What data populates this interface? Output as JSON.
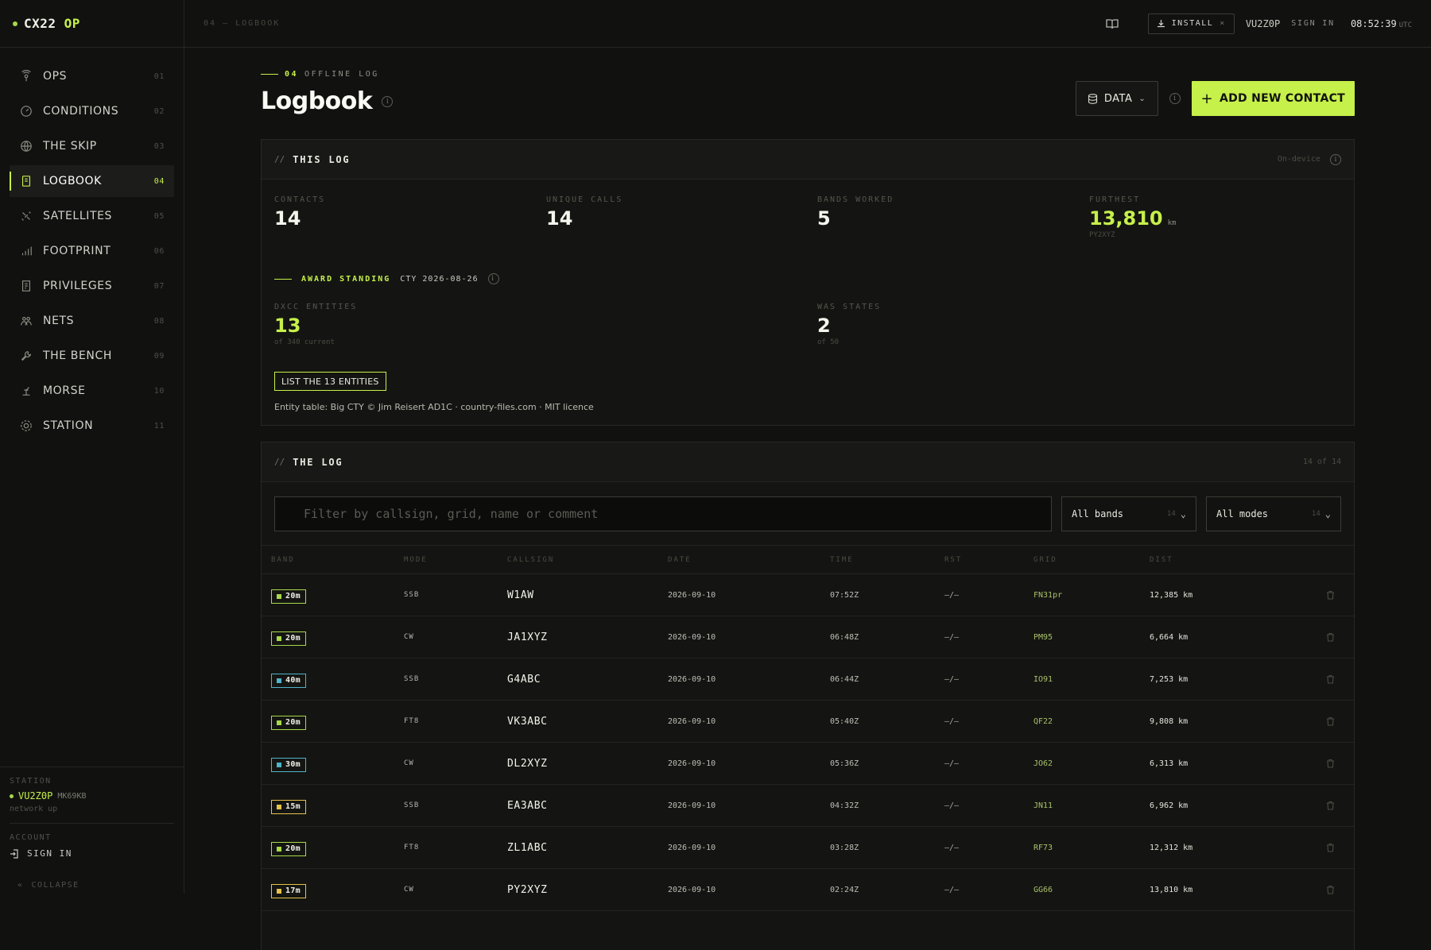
{
  "brand": {
    "name": "CX22",
    "suffix": "OP"
  },
  "crumb": "04 — LOGBOOK",
  "nav": [
    {
      "label": "OPS",
      "num": "01",
      "icon": "antenna-icon"
    },
    {
      "label": "CONDITIONS",
      "num": "02",
      "icon": "gauge-icon"
    },
    {
      "label": "THE SKIP",
      "num": "03",
      "icon": "globe-icon"
    },
    {
      "label": "LOGBOOK",
      "num": "04",
      "icon": "book-icon",
      "active": true
    },
    {
      "label": "SATELLITES",
      "num": "05",
      "icon": "satellite-icon"
    },
    {
      "label": "FOOTPRINT",
      "num": "06",
      "icon": "bars-icon"
    },
    {
      "label": "PRIVILEGES",
      "num": "07",
      "icon": "license-icon"
    },
    {
      "label": "NETS",
      "num": "08",
      "icon": "people-icon"
    },
    {
      "label": "THE BENCH",
      "num": "09",
      "icon": "wrench-icon"
    },
    {
      "label": "MORSE",
      "num": "10",
      "icon": "key-icon"
    },
    {
      "label": "STATION",
      "num": "11",
      "icon": "gear-icon"
    }
  ],
  "sidebar_bottom": {
    "station_label": "STATION",
    "station_call": "VU2Z0P",
    "station_grid": "MK69KB",
    "net_status": "network up",
    "account_label": "ACCOUNT",
    "signin": "SIGN IN",
    "collapse": "COLLAPSE"
  },
  "topbar": {
    "install": "INSTALL",
    "call": "VU2Z0P",
    "signin": "SIGN IN",
    "clock": "08:52:39",
    "tz": "UTC"
  },
  "header": {
    "eyebrow_num": "04",
    "eyebrow_text": "OFFLINE LOG",
    "title": "Logbook",
    "data_label": "DATA",
    "add_label": "ADD NEW CONTACT"
  },
  "this_log": {
    "title": "THIS LOG",
    "badge": "On-device",
    "stats": {
      "contacts": {
        "label": "CONTACTS",
        "value": "14"
      },
      "unique": {
        "label": "UNIQUE CALLS",
        "value": "14"
      },
      "bands": {
        "label": "BANDS WORKED",
        "value": "5"
      },
      "furthest": {
        "label": "FURTHEST",
        "value": "13,810",
        "unit": "km",
        "sub": "PY2XYZ"
      }
    },
    "award": {
      "label": "AWARD STANDING",
      "cty": "CTY 2026-08-26"
    },
    "dxcc": {
      "label": "DXCC ENTITIES",
      "value": "13",
      "sub": "of 340 current"
    },
    "was": {
      "label": "WAS STATES",
      "value": "2",
      "sub": "of 50"
    },
    "list_button": "LIST THE 13 ENTITIES",
    "credits": "Entity table: Big CTY © Jim Reisert AD1C · country-files.com · MIT licence"
  },
  "the_log": {
    "title": "THE LOG",
    "count": "14 of 14",
    "filter_placeholder": "Filter by callsign, grid, name or comment",
    "bands_select": "All bands",
    "bands_count": "14",
    "modes_select": "All modes",
    "modes_count": "14",
    "headers": {
      "band": "BAND",
      "mode": "MODE",
      "callsign": "CALLSIGN",
      "date": "DATE",
      "time": "TIME",
      "rst": "RST",
      "grid": "GRID",
      "dist": "DIST"
    },
    "rows": [
      {
        "band": "20m",
        "mode": "SSB",
        "call": "W1AW",
        "date": "2026-09-10",
        "time": "07:52Z",
        "rst": "–/–",
        "grid": "FN31pr",
        "dist": "12,385 km"
      },
      {
        "band": "20m",
        "mode": "CW",
        "call": "JA1XYZ",
        "date": "2026-09-10",
        "time": "06:48Z",
        "rst": "–/–",
        "grid": "PM95",
        "dist": "6,664 km"
      },
      {
        "band": "40m",
        "mode": "SSB",
        "call": "G4ABC",
        "date": "2026-09-10",
        "time": "06:44Z",
        "rst": "–/–",
        "grid": "IO91",
        "dist": "7,253 km"
      },
      {
        "band": "20m",
        "mode": "FT8",
        "call": "VK3ABC",
        "date": "2026-09-10",
        "time": "05:40Z",
        "rst": "–/–",
        "grid": "QF22",
        "dist": "9,808 km"
      },
      {
        "band": "30m",
        "mode": "CW",
        "call": "DL2XYZ",
        "date": "2026-09-10",
        "time": "05:36Z",
        "rst": "–/–",
        "grid": "JO62",
        "dist": "6,313 km"
      },
      {
        "band": "15m",
        "mode": "SSB",
        "call": "EA3ABC",
        "date": "2026-09-10",
        "time": "04:32Z",
        "rst": "–/–",
        "grid": "JN11",
        "dist": "6,962 km"
      },
      {
        "band": "20m",
        "mode": "FT8",
        "call": "ZL1ABC",
        "date": "2026-09-10",
        "time": "03:28Z",
        "rst": "–/–",
        "grid": "RF73",
        "dist": "12,312 km"
      },
      {
        "band": "17m",
        "mode": "CW",
        "call": "PY2XYZ",
        "date": "2026-09-10",
        "time": "02:24Z",
        "rst": "–/–",
        "grid": "GG66",
        "dist": "13,810 km"
      }
    ]
  },
  "band_colors": {
    "20m": "#a6d94a",
    "40m": "#4fb3c9",
    "30m": "#4fb3c9",
    "15m": "#e5c24a",
    "17m": "#e5c24a"
  },
  "accent": "#c6f04a"
}
